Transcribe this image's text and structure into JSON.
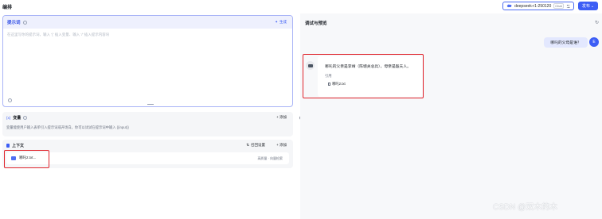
{
  "header": {
    "title": "编排",
    "model_name": "deepseek-r1-250120",
    "model_tag": "Chat",
    "publish_label": "发布",
    "colors": {
      "accent": "#3d5ef5",
      "publish_bg": "#3d5ef5",
      "highlight_red": "#e0242c"
    }
  },
  "prompt": {
    "label": "提示词",
    "generate_label": "生成",
    "placeholder": "在这里写你的提示词，输入 '{' 插入变量、输入 '/' 插入提示内容块"
  },
  "variables": {
    "label": "变量",
    "add_label": "添加",
    "description": "变量能使用户输入表单引入提示词或开场白，你可以试试在提示词中输入 {{input}}"
  },
  "context": {
    "label": "上下文",
    "settings_label": "召回设置",
    "add_label": "添加",
    "items": [
      {
        "name": "哪吒2.txt...",
        "meta": "高质量 · 向量检索"
      }
    ]
  },
  "preview": {
    "title": "调试与预览",
    "user_message": "哪吒的父母是谁？",
    "user_avatar_letter": "E",
    "answer": "哪吒的父亲是李靖（陈塘关总兵），母亲是殷夫人。",
    "citation_label": "引用",
    "citation_file": "哪吒2.txt"
  },
  "watermark": "CSDN @双木的木"
}
